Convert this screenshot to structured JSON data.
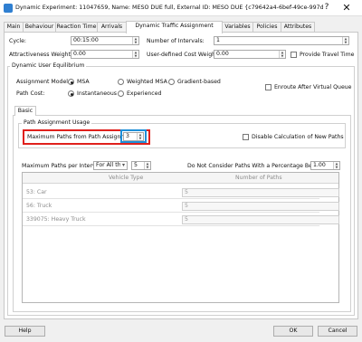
{
  "window": {
    "title": "Dynamic Experiment: 11047659, Name: MESO DUE full, External ID: MESO DUE  {c79642a4-6bef-49ce-997d-42c56...",
    "help_glyph": "?",
    "close_glyph": "✕"
  },
  "tabs": [
    "Main",
    "Behaviour",
    "Reaction Time",
    "Arrivals",
    "Dynamic Traffic Assignment",
    "Variables",
    "Policies",
    "Attributes"
  ],
  "active_tab": "Dynamic Traffic Assignment",
  "form": {
    "cycle_label": "Cycle:",
    "cycle_value": "00:15:00",
    "intervals_label": "Number of Intervals:",
    "intervals_value": "1",
    "attractiveness_label": "Attractiveness Weight:",
    "attractiveness_value": "0.00",
    "user_cost_label": "User-defined Cost Weight:",
    "user_cost_value": "0.00",
    "provide_travel_time_label": "Provide Travel Time"
  },
  "due": {
    "group_title": "Dynamic User Equilibrium",
    "assignment_model_label": "Assignment Model:",
    "model_options": [
      "MSA",
      "Weighted MSA",
      "Gradient-based"
    ],
    "selected_model": "MSA",
    "enroute_label": "Enroute After Virtual Queue",
    "path_cost_label": "Path Cost:",
    "path_cost_options": [
      "Instantaneous",
      "Experienced"
    ],
    "selected_path_cost": "Instantaneous"
  },
  "basic": {
    "tab_label": "Basic",
    "usage_title": "Path Assignment Usage",
    "max_paths_label": "Maximum Paths from Path Assignment:",
    "max_paths_value": "3",
    "disable_label": "Disable Calculation of New Paths",
    "per_interval_label": "Maximum Paths per Interval:",
    "per_interval_select": "For All th",
    "per_interval_value": "5",
    "ignore_label": "Do Not Consider Paths With a Percentage Below:",
    "ignore_value": "1.00"
  },
  "table": {
    "columns": [
      "Vehicle Type",
      "Number of Paths"
    ],
    "rows": [
      {
        "vehicle": "53: Car",
        "paths": "5"
      },
      {
        "vehicle": "56: Truck",
        "paths": "5"
      },
      {
        "vehicle": "339075: Heavy Truck",
        "paths": "5"
      }
    ]
  },
  "footer": {
    "help_label": "Help",
    "ok_label": "OK",
    "cancel_label": "Cancel"
  },
  "colors": {
    "highlight_red": "#e0201c",
    "highlight_blue": "#1e8fd8"
  },
  "icons": {
    "app": "experiment-app-icon",
    "spin_up": "▲",
    "spin_down": "▼",
    "dropdown": "▾"
  }
}
